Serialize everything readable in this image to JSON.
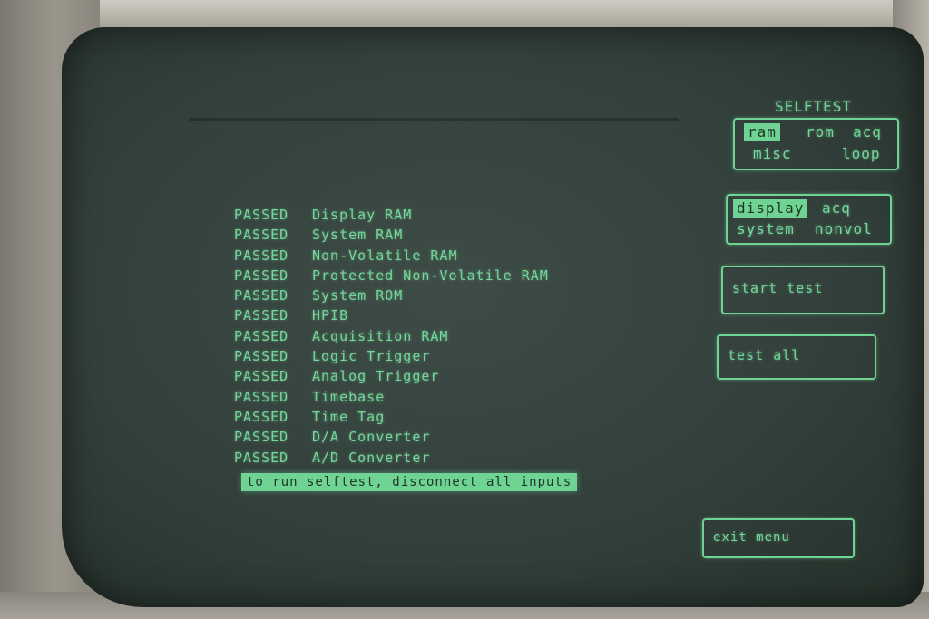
{
  "menu": {
    "title": "SELFTEST",
    "test_group_options": [
      {
        "label": "ram",
        "selected": true
      },
      {
        "label": "rom",
        "selected": false
      },
      {
        "label": "acq",
        "selected": false
      },
      {
        "label": "misc",
        "selected": false
      },
      {
        "label": "loop",
        "selected": false
      }
    ],
    "ram_options": [
      {
        "label": "display",
        "selected": true
      },
      {
        "label": "acq",
        "selected": false
      },
      {
        "label": "system",
        "selected": false
      },
      {
        "label": "nonvol",
        "selected": false
      }
    ],
    "start_test_label": "start test",
    "test_all_label": "test all",
    "exit_menu_label": "exit menu"
  },
  "results": [
    {
      "status": "PASSED",
      "test": "Display RAM"
    },
    {
      "status": "PASSED",
      "test": "System RAM"
    },
    {
      "status": "PASSED",
      "test": "Non-Volatile RAM"
    },
    {
      "status": "PASSED",
      "test": "Protected Non-Volatile RAM"
    },
    {
      "status": "PASSED",
      "test": "System ROM"
    },
    {
      "status": "PASSED",
      "test": "HPIB"
    },
    {
      "status": "PASSED",
      "test": "Acquisition RAM"
    },
    {
      "status": "PASSED",
      "test": "Logic Trigger"
    },
    {
      "status": "PASSED",
      "test": "Analog Trigger"
    },
    {
      "status": "PASSED",
      "test": "Timebase"
    },
    {
      "status": "PASSED",
      "test": "Time Tag"
    },
    {
      "status": "PASSED",
      "test": "D/A Converter"
    },
    {
      "status": "PASSED",
      "test": "A/D Converter"
    }
  ],
  "notice": "to run selftest, disconnect all inputs",
  "colors": {
    "phosphor": "#74d79a",
    "screen": "#33403c"
  }
}
